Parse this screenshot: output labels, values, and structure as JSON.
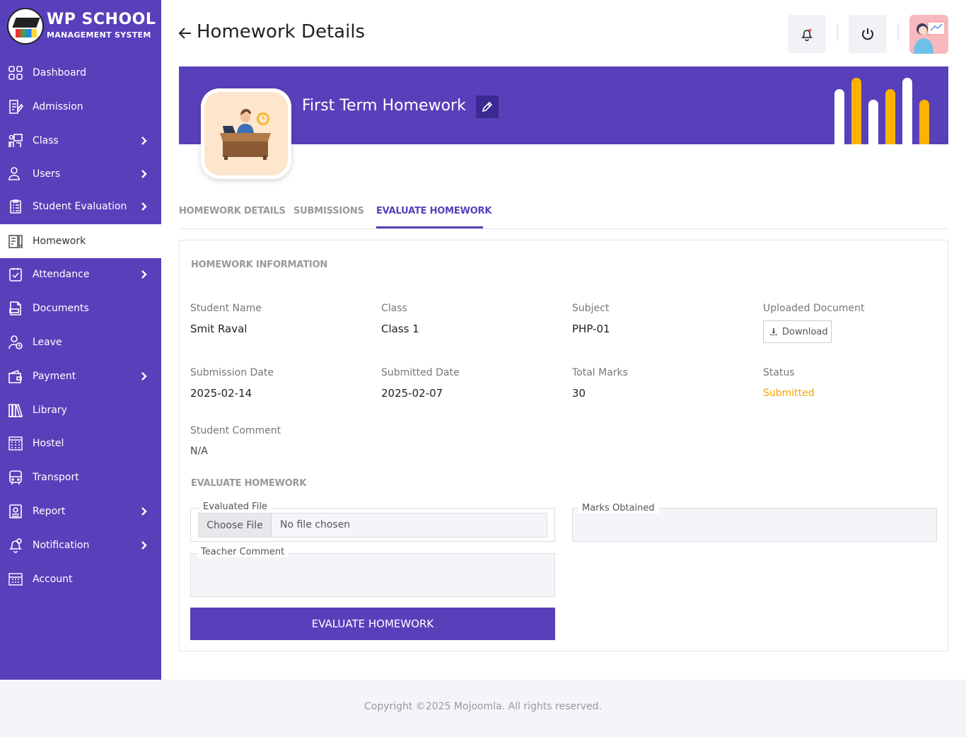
{
  "brand": {
    "title": "WP SCHOOL",
    "subtitle": "MANAGEMENT SYSTEM"
  },
  "sidebar": {
    "items": [
      {
        "label": "Dashboard",
        "icon": "dashboard-icon",
        "has_children": false,
        "active": false
      },
      {
        "label": "Admission",
        "icon": "admission-icon",
        "has_children": false,
        "active": false
      },
      {
        "label": "Class",
        "icon": "class-icon",
        "has_children": true,
        "active": false
      },
      {
        "label": "Users",
        "icon": "user-icon",
        "has_children": true,
        "active": false
      },
      {
        "label": "Student Evaluation",
        "icon": "evaluation-icon",
        "has_children": true,
        "active": false
      },
      {
        "label": "Homework",
        "icon": "homework-icon",
        "has_children": false,
        "active": true
      },
      {
        "label": "Attendance",
        "icon": "attendance-icon",
        "has_children": true,
        "active": false
      },
      {
        "label": "Documents",
        "icon": "document-icon",
        "has_children": false,
        "active": false
      },
      {
        "label": "Leave",
        "icon": "leave-icon",
        "has_children": false,
        "active": false
      },
      {
        "label": "Payment",
        "icon": "wallet-icon",
        "has_children": true,
        "active": false
      },
      {
        "label": "Library",
        "icon": "library-icon",
        "has_children": false,
        "active": false
      },
      {
        "label": "Hostel",
        "icon": "hostel-icon",
        "has_children": false,
        "active": false
      },
      {
        "label": "Transport",
        "icon": "bus-icon",
        "has_children": false,
        "active": false
      },
      {
        "label": "Report",
        "icon": "report-icon",
        "has_children": true,
        "active": false
      },
      {
        "label": "Notification",
        "icon": "notification-icon",
        "has_children": true,
        "active": false
      },
      {
        "label": "Account",
        "icon": "account-icon",
        "has_children": false,
        "active": false
      }
    ]
  },
  "header": {
    "title": "Homework Details"
  },
  "banner": {
    "title": "First Term Homework"
  },
  "tabs": [
    {
      "label": "HOMEWORK DETAILS",
      "active": false
    },
    {
      "label": "SUBMISSIONS",
      "active": false
    },
    {
      "label": "EVALUATE HOMEWORK",
      "active": true
    }
  ],
  "info": {
    "section_title": "HOMEWORK INFORMATION",
    "student_name_label": "Student Name",
    "student_name": "Smit Raval",
    "class_label": "Class",
    "class": "Class 1",
    "subject_label": "Subject",
    "subject": "PHP-01",
    "uploaded_document_label": "Uploaded Document",
    "download_label": "Download",
    "submission_date_label": "Submission Date",
    "submission_date": "2025-02-14",
    "submitted_date_label": "Submitted Date",
    "submitted_date": "2025-02-07",
    "total_marks_label": "Total Marks",
    "total_marks": "30",
    "status_label": "Status",
    "status": "Submitted",
    "student_comment_label": "Student Comment",
    "student_comment": "N/A"
  },
  "evaluate": {
    "section_title": "EVALUATE HOMEWORK",
    "evaluated_file_label": "Evaluated File",
    "choose_file_label": "Choose File",
    "no_file_label": "No file chosen",
    "marks_obtained_label": "Marks Obtained",
    "marks_obtained_value": "",
    "teacher_comment_label": "Teacher Comment",
    "teacher_comment_value": "",
    "submit_label": "EVALUATE HOMEWORK"
  },
  "footer": {
    "copyright": "Copyright ©2025 Mojoomla. All rights reserved."
  },
  "colors": {
    "primary": "#5840bb",
    "status_submitted": "#f5a300",
    "bar_white": "#ffffff",
    "bar_yellow": "#ffb300"
  }
}
